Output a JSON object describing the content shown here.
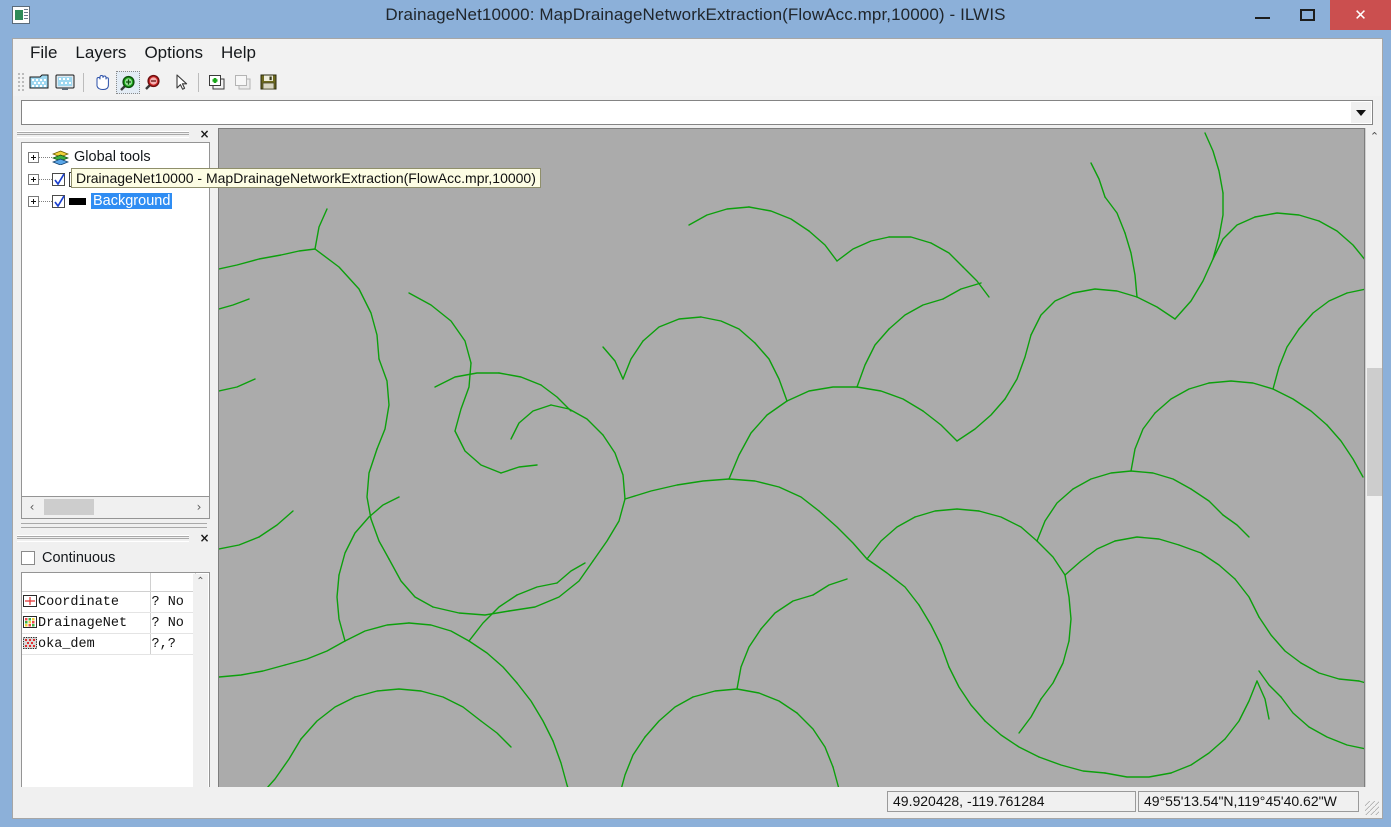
{
  "window": {
    "title": "DrainageNet10000: MapDrainageNetworkExtraction(FlowAcc.mpr,10000) - ILWIS",
    "app_icon": "ilwis-map-icon",
    "minimize_label": "–",
    "maximize_label": "□",
    "close_label": "✕"
  },
  "menu": {
    "items": [
      {
        "label": "File"
      },
      {
        "label": "Layers"
      },
      {
        "label": "Options"
      },
      {
        "label": "Help"
      }
    ]
  },
  "toolbar": {
    "buttons": [
      {
        "name": "open-map-icon",
        "tooltip": "Open Map",
        "state": "normal"
      },
      {
        "name": "display-options-icon",
        "tooltip": "Display Options",
        "state": "normal"
      },
      {
        "name": "pan-hand-icon",
        "tooltip": "Pan",
        "state": "normal"
      },
      {
        "name": "zoom-in-icon",
        "tooltip": "Zoom In",
        "state": "active"
      },
      {
        "name": "zoom-out-icon",
        "tooltip": "Zoom Out",
        "state": "normal"
      },
      {
        "name": "select-arrow-icon",
        "tooltip": "Select",
        "state": "normal"
      },
      {
        "name": "add-layer-icon",
        "tooltip": "Add Layer",
        "state": "normal"
      },
      {
        "name": "copy-layer-icon",
        "tooltip": "Copy Layer",
        "state": "disabled"
      },
      {
        "name": "save-icon",
        "tooltip": "Save",
        "state": "normal"
      }
    ]
  },
  "command_bar": {
    "value": "",
    "placeholder": ""
  },
  "layer_panel": {
    "close_label": "×",
    "tooltip": "DrainageNet10000 - MapDrainageNetworkExtraction(FlowAcc.mpr,10000)",
    "items": [
      {
        "label": "Global tools",
        "icon": "layer-stack-icon",
        "has_checkbox": false,
        "checked": false,
        "selected": false,
        "expandable": true
      },
      {
        "label": "DrainageNet10000",
        "icon": "raster-map-icon",
        "has_checkbox": true,
        "checked": true,
        "selected": false,
        "expandable": true
      },
      {
        "label": "Background",
        "icon": "black-bar-icon",
        "has_checkbox": true,
        "checked": true,
        "selected": true,
        "expandable": true
      }
    ],
    "hscroll": {
      "left_arrow": "‹",
      "right_arrow": "›"
    }
  },
  "attribute_panel": {
    "close_label": "×",
    "continuous_label": "Continuous",
    "continuous_checked": false,
    "columns": [
      "",
      ""
    ],
    "rows": [
      {
        "icon": "coordinate-icon",
        "name": "Coordinate",
        "value": "? No"
      },
      {
        "icon": "raster-map-icon",
        "name": "DrainageNet",
        "value": "? No"
      },
      {
        "icon": "dem-raster-icon",
        "name": "oka_dem",
        "value": "?,?"
      }
    ],
    "scroll_up_arrow": "⌃"
  },
  "map": {
    "background_color": "#ababab",
    "line_color": "#0ca00c",
    "vscroll": {
      "up_arrow": "⌃",
      "down_arrow": "⌄"
    },
    "hscroll": {
      "left_arrow": "‹",
      "right_arrow": "›"
    }
  },
  "status_bar": {
    "coordinate": "49.920428, -119.761284",
    "latlon": "49°55'13.54\"N,119°45'40.62\"W"
  }
}
